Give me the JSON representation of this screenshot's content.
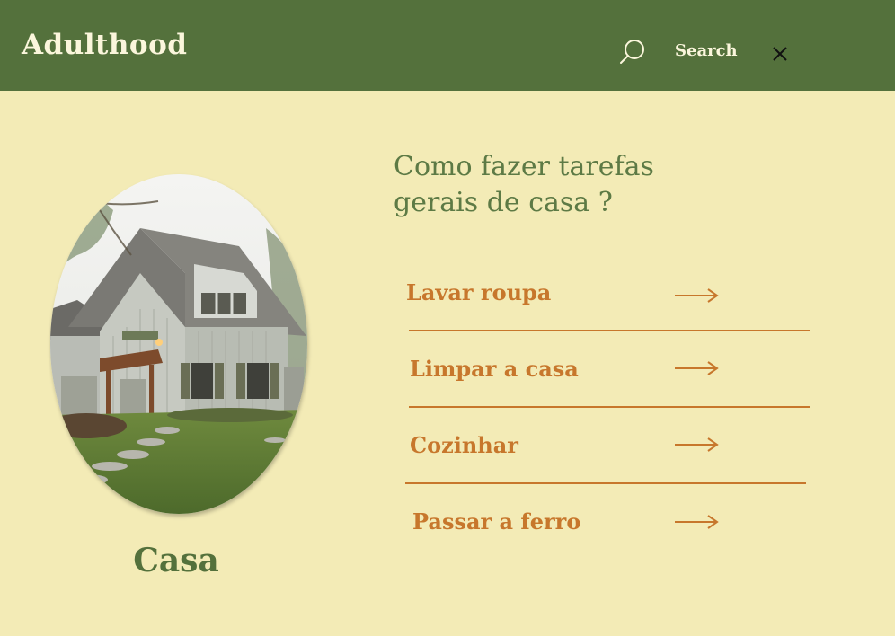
{
  "header": {
    "brand": "Adulthood",
    "search_label": "Search",
    "search_icon": "search-icon",
    "close_icon": "close-icon"
  },
  "sidebar": {
    "caption": "Casa"
  },
  "main": {
    "heading_line1": "Como fazer tarefas",
    "heading_line2": "gerais de casa ?",
    "items": [
      {
        "label": "Lavar roupa",
        "icon": "arrow-right-icon"
      },
      {
        "label": "Limpar a casa",
        "icon": "arrow-right-icon"
      },
      {
        "label": "Cozinhar",
        "icon": "arrow-right-icon"
      },
      {
        "label": "Passar a ferro",
        "icon": "arrow-right-icon"
      }
    ]
  },
  "colors": {
    "header_bg": "#54713c",
    "page_bg": "#f3ebb6",
    "accent": "#c7772c",
    "heading": "#5d7a45"
  }
}
